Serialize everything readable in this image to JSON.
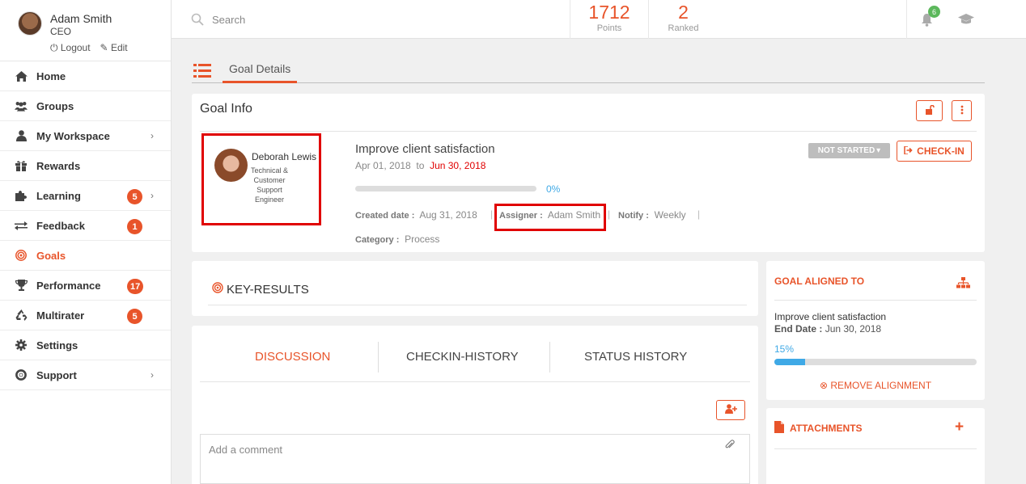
{
  "user": {
    "name": "Adam Smith",
    "role": "CEO",
    "logout": "Logout",
    "edit": "Edit"
  },
  "nav": [
    {
      "label": "Home",
      "icon": "home-icon"
    },
    {
      "label": "Groups",
      "icon": "users-icon"
    },
    {
      "label": "My Workspace",
      "icon": "user-icon",
      "chevron": true
    },
    {
      "label": "Rewards",
      "icon": "gift-icon"
    },
    {
      "label": "Learning",
      "icon": "puzzle-icon",
      "badge": "5",
      "chevron": true
    },
    {
      "label": "Feedback",
      "icon": "exchange-icon",
      "badge": "1"
    },
    {
      "label": "Goals",
      "icon": "target-icon",
      "active": true
    },
    {
      "label": "Performance",
      "icon": "trophy-icon",
      "badge": "17"
    },
    {
      "label": "Multirater",
      "icon": "recycle-icon",
      "badge": "5"
    },
    {
      "label": "Settings",
      "icon": "gear-icon"
    },
    {
      "label": "Support",
      "icon": "lifebuoy-icon",
      "chevron": true
    }
  ],
  "search": {
    "placeholder": "Search"
  },
  "stats": {
    "points_value": "1712",
    "points_label": "Points",
    "ranked_value": "2",
    "ranked_label": "Ranked"
  },
  "notifications": {
    "count": "6"
  },
  "page": {
    "tab": "Goal Details"
  },
  "goal_info": {
    "title": "Goal Info",
    "owner_name": "Deborah Lewis",
    "owner_role": "Technical & Customer Support Engineer",
    "goal_name": "Improve client satisfaction",
    "start_date": "Apr 01, 2018",
    "to": "to",
    "end_date": "Jun 30, 2018",
    "progress_label": "0%",
    "progress": 0,
    "created_label": "Created date :",
    "created_value": "Aug 31, 2018",
    "assigner_label": "Assigner :",
    "assigner_value": "Adam Smith",
    "notify_label": "Notify :",
    "notify_value": "Weekly",
    "category_label": "Category :",
    "category_value": "Process",
    "status": "NOT STARTED",
    "checkin": "CHECK-IN"
  },
  "key_results": {
    "title": "KEY-RESULTS"
  },
  "discussion": {
    "tabs": [
      "DISCUSSION",
      "CHECKIN-HISTORY",
      "STATUS HISTORY"
    ],
    "comment_placeholder": "Add a comment"
  },
  "aligned": {
    "title": "GOAL ALIGNED TO",
    "goal": "Improve client satisfaction",
    "end_label": "End Date :",
    "end_value": "Jun 30, 2018",
    "progress_label": "15%",
    "progress": 0.15,
    "remove": "REMOVE ALIGNMENT"
  },
  "attachments": {
    "title": "ATTACHMENTS"
  },
  "colors": {
    "accent": "#e8542a",
    "blue": "#3fa9e6",
    "highlight": "#e00000",
    "green": "#5cb85c"
  }
}
